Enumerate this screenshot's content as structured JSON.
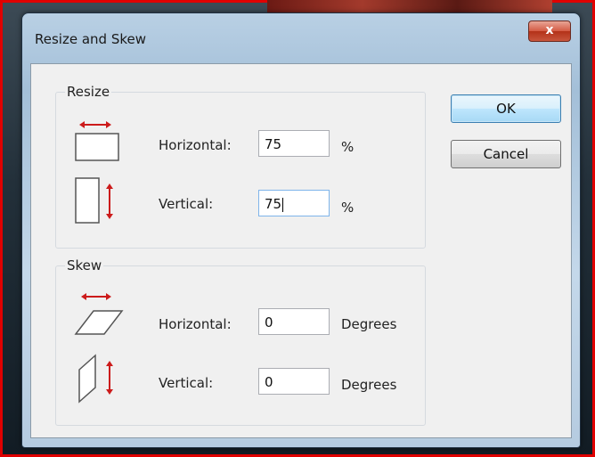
{
  "window": {
    "title": "Resize and Skew",
    "close_symbol": "x"
  },
  "resize": {
    "label": "Resize",
    "horizontal_label": "Horizontal:",
    "horizontal_value": "75",
    "horizontal_unit": "%",
    "vertical_label": "Vertical:",
    "vertical_value": "75",
    "vertical_unit": "%"
  },
  "skew": {
    "label": "Skew",
    "horizontal_label": "Horizontal:",
    "horizontal_value": "0",
    "horizontal_unit": "Degrees",
    "vertical_label": "Vertical:",
    "vertical_value": "0",
    "vertical_unit": "Degrees"
  },
  "buttons": {
    "ok": "OK",
    "cancel": "Cancel"
  },
  "colors": {
    "arrow": "#cc1b1b",
    "accent_border": "#e00000"
  }
}
